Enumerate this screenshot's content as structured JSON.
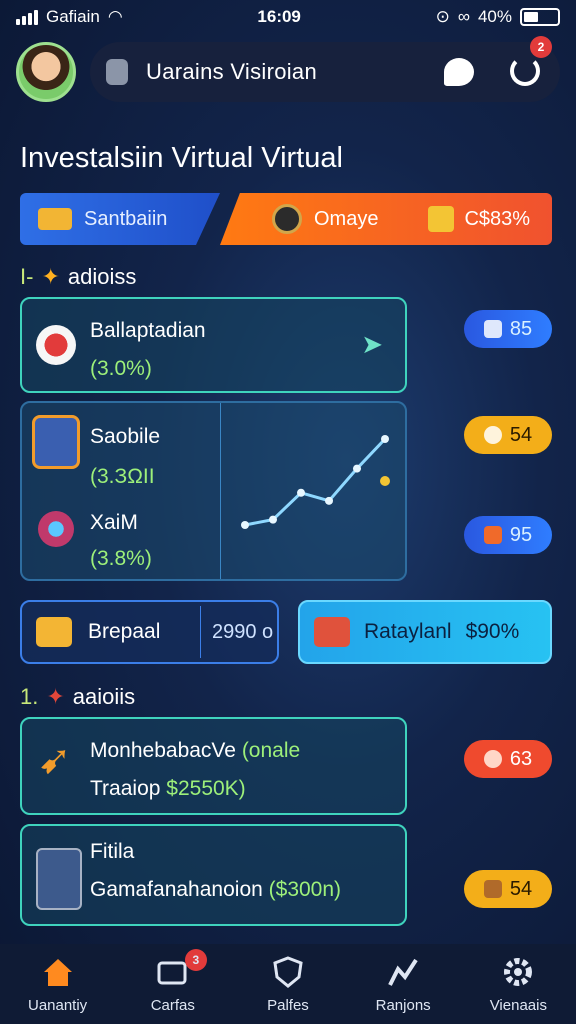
{
  "status_bar": {
    "carrier": "Gafiain",
    "time": "16:09",
    "battery": "40%"
  },
  "header": {
    "app_title": "Uarains Visiroian",
    "notification_count": "2"
  },
  "page_title": "Investalsiin Virtual Virtual",
  "tabs": [
    {
      "label": "Santbaiin"
    },
    {
      "label": "Omaye",
      "value": "C$83%"
    }
  ],
  "section_1": {
    "prefix": "I-",
    "title": "adioiss"
  },
  "section_1_cards": [
    {
      "name": "Ballaptadian",
      "pct": "(3.0%)"
    },
    {
      "name": "Saobile",
      "pct": "(3.ЗΩII"
    },
    {
      "name": "XaiM",
      "pct": "(3.8%)"
    }
  ],
  "side_pills": [
    "85",
    "54",
    "95",
    "63",
    "54"
  ],
  "balance": {
    "left_label": "Brepaal",
    "left_value": "2990 o",
    "right_label": "Rataylanl",
    "right_value": "$90%"
  },
  "section_2": {
    "prefix": "1.",
    "title": "aaioiis"
  },
  "section_2_cards": [
    {
      "name": "MonhebabacVe",
      "extra": "(onale",
      "sub": "Traaiop",
      "sub_value": "$2550K)"
    },
    {
      "name": "Fitila",
      "sub": "Gamafanahanoion",
      "sub_value": "($300n)"
    }
  ],
  "nav": [
    {
      "label": "Uanantiy",
      "icon": "home-icon"
    },
    {
      "label": "Carfas",
      "icon": "cards-icon",
      "badge": "3"
    },
    {
      "label": "Palfes",
      "icon": "shield-icon"
    },
    {
      "label": "Ranjons",
      "icon": "chart-icon"
    },
    {
      "label": "Vienaais",
      "icon": "gear-icon"
    }
  ],
  "colors": {
    "accent_teal": "#3fd3bd",
    "tab_blue": "#2f6fe6",
    "tab_orange": "#ff7a12",
    "positive_green": "#9df07a",
    "badge_red": "#e23b3b"
  },
  "chart_data": {
    "type": "line",
    "values": [
      1,
      1.2,
      2.2,
      1.9,
      3.1,
      4.2
    ]
  }
}
